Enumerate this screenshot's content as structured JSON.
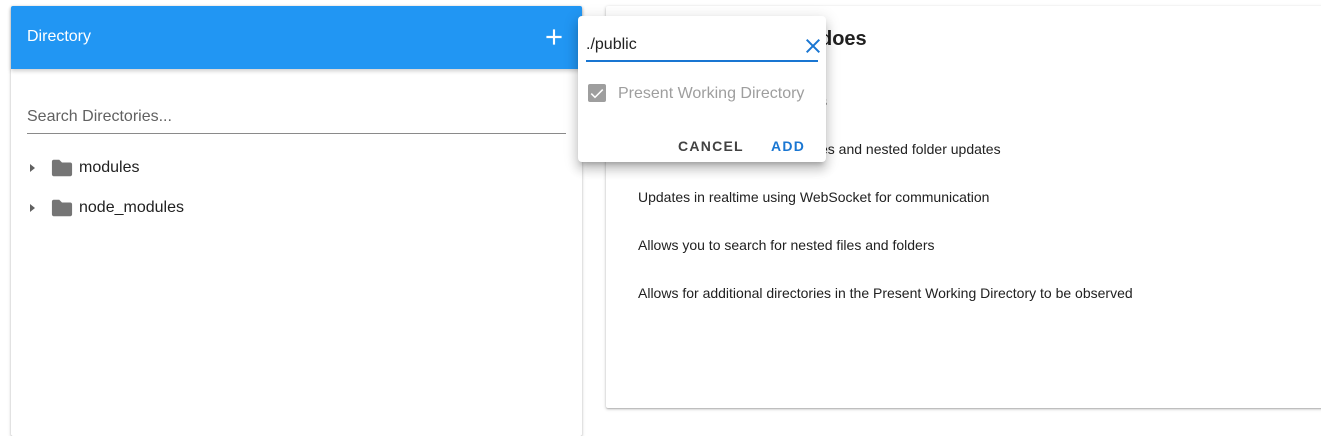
{
  "directory_panel": {
    "title": "Directory",
    "add_icon": "plus-icon",
    "search": {
      "placeholder": "Search Directories...",
      "value": ""
    },
    "items": [
      {
        "label": "modules",
        "icon": "folder-icon",
        "expanded": false
      },
      {
        "label": "node_modules",
        "icon": "folder-icon",
        "expanded": false
      }
    ]
  },
  "content": {
    "title": "does",
    "features": [
      "s",
      "es and nested folder updates",
      "Updates in realtime using WebSocket for communication",
      "Allows you to search for nested files and folders",
      "Allows for additional directories in the Present Working Directory to be observed"
    ]
  },
  "add_dialog": {
    "path_value": "./public",
    "clear_icon": "close-icon",
    "checkbox_label": "Present Working Directory",
    "checkbox_checked": true,
    "checkbox_disabled": true,
    "cancel_label": "CANCEL",
    "add_label": "ADD"
  },
  "colors": {
    "header_bg": "#2196f3",
    "accent": "#1976d2",
    "disabled": "#9e9e9e"
  }
}
